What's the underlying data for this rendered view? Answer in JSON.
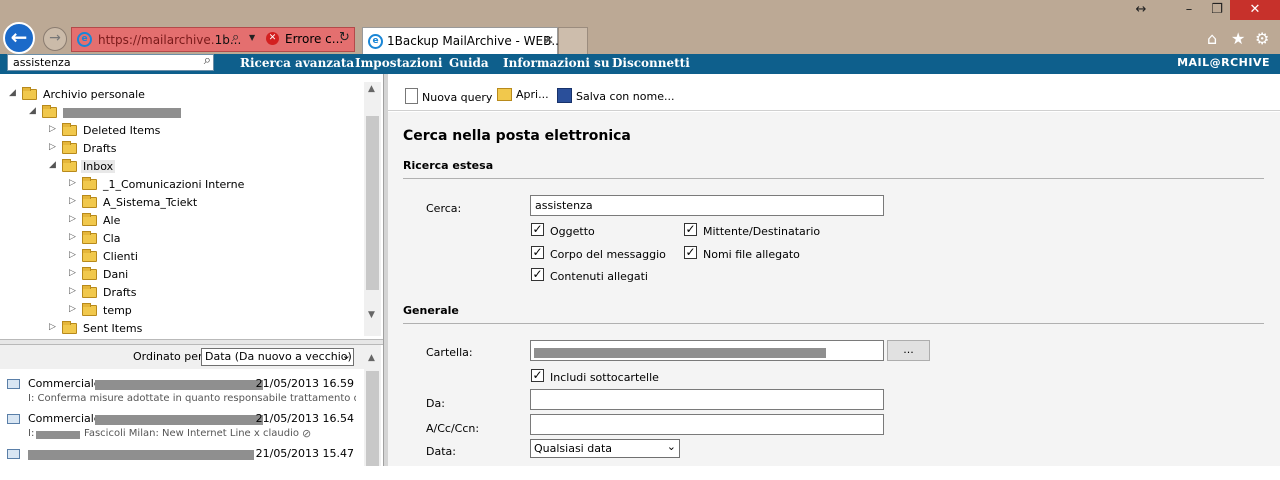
{
  "browser": {
    "url_prefix": "https://mailarchive.",
    "url_host": "1b...",
    "cert_error": "Errore c...",
    "tab_title": "1Backup MailArchive - WEB...",
    "controls": {
      "resize": "↔",
      "minimize": "–",
      "restore": "❐",
      "close": "✕"
    }
  },
  "menubar": {
    "search_value": "assistenza",
    "items": [
      "Ricerca avanzata",
      "Impostazioni",
      "Guida",
      "Informazioni su",
      "Disconnetti"
    ],
    "brand": "MAIL@RCHIVE"
  },
  "tree": {
    "root": "Archivio personale",
    "items": [
      "Deleted Items",
      "Drafts",
      "Inbox",
      "_1_Comunicazioni Interne",
      "A_Sistema_Tciekt",
      "Ale",
      "Cla",
      "Clienti",
      "Dani",
      "Drafts",
      "temp",
      "Sent Items"
    ]
  },
  "sort": {
    "label": "Ordinato per:",
    "value": "Data (Da nuovo a vecchio)"
  },
  "mails": [
    {
      "from": "Commerciale",
      "date": "21/05/2013 16.59",
      "subject": "I: Conferma misure adottate in quanto responsabile trattamento da"
    },
    {
      "from": "Commerciale",
      "date": "21/05/2013 16.54",
      "subject_prefix": "I:",
      "subject": "Fascicoli Milan: New Internet Line x claudio"
    },
    {
      "from": "",
      "date": "21/05/2013 15.47",
      "subject": ""
    }
  ],
  "toolbar": {
    "new_query": "Nuova query",
    "open": "Apri...",
    "save_as": "Salva con nome..."
  },
  "form": {
    "title": "Cerca nella posta elettronica",
    "section_ext": "Ricerca estesa",
    "cerca_label": "Cerca:",
    "cerca_value": "assistenza",
    "checks": {
      "oggetto": "Oggetto",
      "mittente": "Mittente/Destinatario",
      "corpo": "Corpo del messaggio",
      "nomi_file": "Nomi file allegato",
      "contenuti": "Contenuti allegati"
    },
    "section_gen": "Generale",
    "cartella_label": "Cartella:",
    "browse": "...",
    "includi": "Includi sottocartelle",
    "da_label": "Da:",
    "acc_label": "A/Cc/Ccn:",
    "data_label": "Data:",
    "data_value": "Qualsiasi data"
  }
}
